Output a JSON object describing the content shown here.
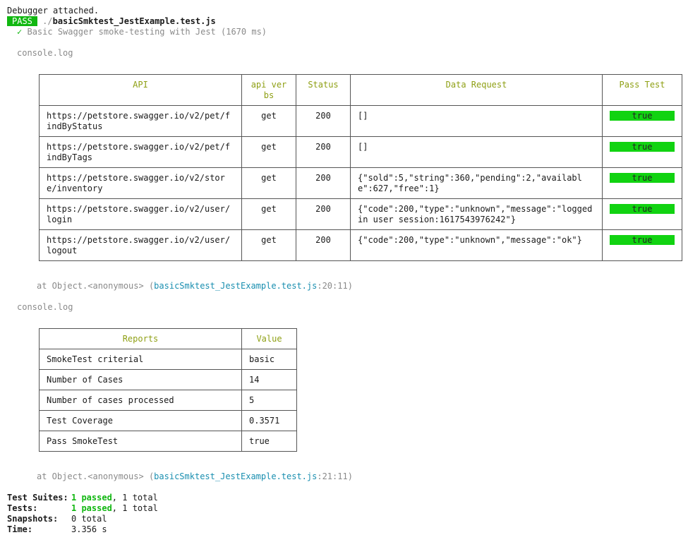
{
  "header": {
    "debugger": "Debugger attached.",
    "badge": "PASS",
    "path_prefix": "./",
    "file": "basicSmktest_JestExample.test.js",
    "check": "✓",
    "test_name": "Basic Swagger smoke-testing with Jest (1670 ms)"
  },
  "console_label": "console.log",
  "api_table": {
    "headers": [
      "API",
      "api verbs",
      "Status",
      "Data Request",
      "Pass Test"
    ],
    "rows": [
      {
        "api": "https://petstore.swagger.io/v2/pet/findByStatus",
        "verb": "get",
        "status": "200",
        "data": "[]",
        "pass": "true"
      },
      {
        "api": "https://petstore.swagger.io/v2/pet/findByTags",
        "verb": "get",
        "status": "200",
        "data": "[]",
        "pass": "true"
      },
      {
        "api": "https://petstore.swagger.io/v2/store/inventory",
        "verb": "get",
        "status": "200",
        "data": "{\"sold\":5,\"string\":360,\"pending\":2,\"available\":627,\"free\":1}",
        "pass": "true"
      },
      {
        "api": "https://petstore.swagger.io/v2/user/login",
        "verb": "get",
        "status": "200",
        "data": "{\"code\":200,\"type\":\"unknown\",\"message\":\"logged in user session:1617543976242\"}",
        "pass": "true"
      },
      {
        "api": "https://petstore.swagger.io/v2/user/logout",
        "verb": "get",
        "status": "200",
        "data": "{\"code\":200,\"type\":\"unknown\",\"message\":\"ok\"}",
        "pass": "true"
      }
    ]
  },
  "trace1": {
    "prefix": "at Object.<anonymous> (",
    "file": "basicSmktest_JestExample.test.js",
    "loc": ":20:11)"
  },
  "report_table": {
    "headers": [
      "Reports",
      "Value"
    ],
    "rows": [
      {
        "report": "SmokeTest criterial",
        "value": "basic"
      },
      {
        "report": "Number of Cases",
        "value": "14"
      },
      {
        "report": "Number of cases processed",
        "value": "5"
      },
      {
        "report": "Test Coverage",
        "value": "0.3571"
      },
      {
        "report": "Pass SmokeTest",
        "value": "true"
      }
    ]
  },
  "trace2": {
    "prefix": "at Object.<anonymous> (",
    "file": "basicSmktest_JestExample.test.js",
    "loc": ":21:11)"
  },
  "summary": {
    "suites_label": "Test Suites:",
    "suites_passed": "1 passed",
    "suites_rest": ", 1 total",
    "tests_label": "Tests:",
    "tests_passed": "1 passed",
    "tests_rest": ", 1 total",
    "snapshots_label": "Snapshots:",
    "snapshots_value": "0 total",
    "time_label": "Time:",
    "time_value": "3.356 s"
  }
}
